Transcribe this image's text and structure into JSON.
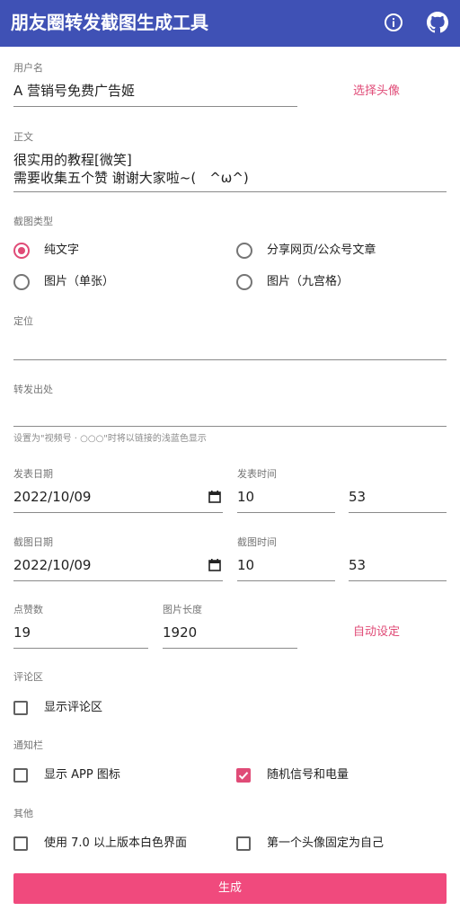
{
  "app": {
    "title": "朋友圈转发截图生成工具",
    "accent": "#3f51b5",
    "pink": "#e04b77"
  },
  "toolbar": {
    "info_icon": "info-icon",
    "github_icon": "github-icon"
  },
  "username": {
    "label": "用户名",
    "value": "A 营销号免费广告姬",
    "avatar_button": "选择头像"
  },
  "body": {
    "label": "正文",
    "value": "很实用的教程[微笑]\n需要收集五个赞 谢谢大家啦~(　^ω^)"
  },
  "screenshot_type": {
    "label": "截图类型",
    "options": [
      {
        "label": "纯文字",
        "selected": true
      },
      {
        "label": "分享网页/公众号文章",
        "selected": false
      },
      {
        "label": "图片（单张）",
        "selected": false
      },
      {
        "label": "图片（九宫格）",
        "selected": false
      }
    ]
  },
  "location": {
    "label": "定位",
    "value": ""
  },
  "forward_source": {
    "label": "转发出处",
    "value": "",
    "hint": "设置为\"视频号 · ○○○\"时将以链接的浅蓝色显示"
  },
  "post": {
    "date_label": "发表日期",
    "date": "2022/10/09",
    "time_label": "发表时间",
    "hour": "10",
    "minute": "53"
  },
  "capture": {
    "date_label": "截图日期",
    "date": "2022/10/09",
    "time_label": "截图时间",
    "hour": "10",
    "minute": "53"
  },
  "likes": {
    "label": "点赞数",
    "value": "19"
  },
  "image_length": {
    "label": "图片长度",
    "value": "1920",
    "auto_button": "自动设定"
  },
  "comments": {
    "label": "评论区",
    "show_label": "显示评论区",
    "checked": false
  },
  "notification": {
    "label": "通知栏",
    "show_app_icon": {
      "label": "显示 APP 图标",
      "checked": false
    },
    "random_signal": {
      "label": "随机信号和电量",
      "checked": true
    }
  },
  "other": {
    "label": "其他",
    "white_ui": {
      "label": "使用 7.0 以上版本白色界面",
      "checked": false
    },
    "first_avatar_self": {
      "label": "第一个头像固定为自己",
      "checked": false
    }
  },
  "generate_button": "生成"
}
